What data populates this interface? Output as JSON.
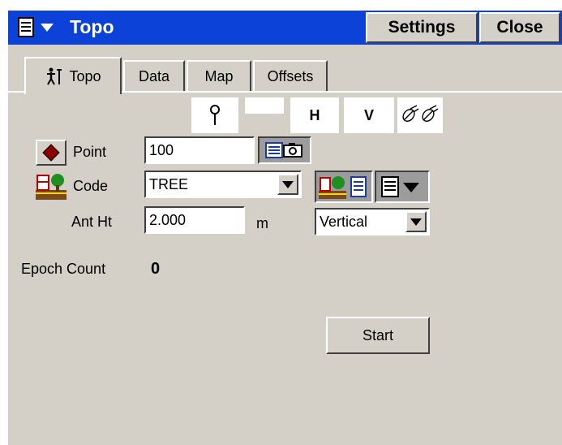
{
  "window": {
    "title": "Topo",
    "settings_label": "Settings",
    "close_label": "Close",
    "title_bg": "#0c42d8",
    "panel_bg": "#d4d0c8"
  },
  "tabs": [
    {
      "label": "Topo",
      "icon": "surveyor-icon",
      "active": true
    },
    {
      "label": "Data",
      "active": false
    },
    {
      "label": "Map",
      "active": false
    },
    {
      "label": "Offsets",
      "active": false
    }
  ],
  "status": {
    "h_label": "H",
    "v_label": "V"
  },
  "form": {
    "point_label": "Point",
    "point_value": "100",
    "code_label": "Code",
    "code_value": "TREE",
    "ant_ht_label": "Ant Ht",
    "ant_ht_value": "2.000",
    "ant_ht_unit": "m",
    "measure_method": "Vertical"
  },
  "epoch": {
    "label": "Epoch Count",
    "value": "0"
  },
  "start_label": "Start"
}
